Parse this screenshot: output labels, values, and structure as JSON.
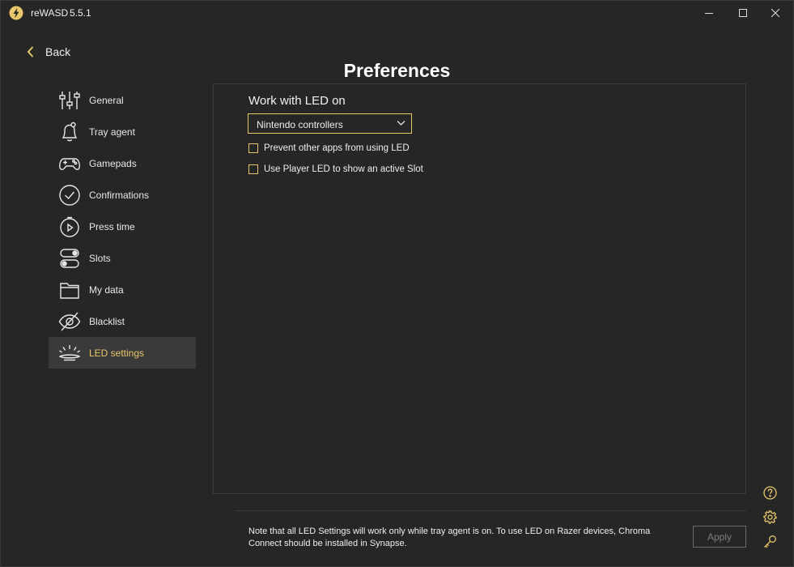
{
  "app": {
    "name": "reWASD",
    "version": "5.5.1"
  },
  "colors": {
    "accent": "#e8c66a",
    "background": "#262626",
    "active_item": "#3a3a3a"
  },
  "nav": {
    "back_label": "Back"
  },
  "page_title": "Preferences",
  "sidebar": {
    "items": [
      {
        "label": "General",
        "icon": "sliders-icon"
      },
      {
        "label": "Tray agent",
        "icon": "bell-icon"
      },
      {
        "label": "Gamepads",
        "icon": "gamepad-icon"
      },
      {
        "label": "Confirmations",
        "icon": "check-circle-icon"
      },
      {
        "label": "Press time",
        "icon": "stopwatch-icon"
      },
      {
        "label": "Slots",
        "icon": "toggles-icon"
      },
      {
        "label": "My data",
        "icon": "folder-icon"
      },
      {
        "label": "Blacklist",
        "icon": "eye-slash-icon"
      },
      {
        "label": "LED settings",
        "icon": "led-icon",
        "active": true
      }
    ]
  },
  "led": {
    "section_title": "Work with LED on",
    "dropdown_value": "Nintendo controllers",
    "options": [
      {
        "label": "Prevent other apps from using LED",
        "checked": false
      },
      {
        "label": "Use Player LED to show an active Slot",
        "checked": false
      }
    ]
  },
  "footer": {
    "note": "Note that all LED Settings will work only while tray agent is on. To use LED on Razer devices, Chroma Connect should be installed in Synapse.",
    "apply_label": "Apply"
  },
  "corner_icons": [
    "help-icon",
    "gear-icon",
    "key-icon"
  ]
}
